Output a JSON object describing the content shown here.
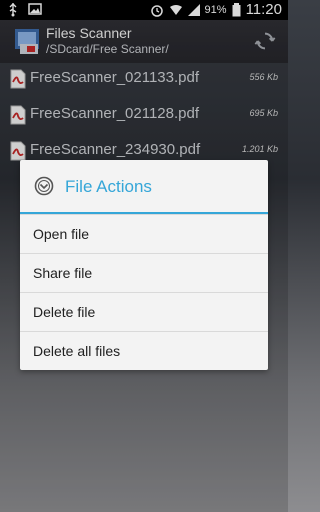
{
  "status_bar": {
    "time": "11:20",
    "battery_percent": "91%",
    "icons": [
      "usb-icon",
      "image-icon",
      "alarm-icon",
      "wifi-icon",
      "signal-icon",
      "battery-icon"
    ]
  },
  "action_bar": {
    "title": "Files Scanner",
    "subtitle": "/SDcard/Free Scanner/",
    "icons": [
      "app-icon",
      "refresh-icon"
    ]
  },
  "files": [
    {
      "name": "FreeScanner_021133.pdf",
      "size": "556 Kb"
    },
    {
      "name": "FreeScanner_021128.pdf",
      "size": "695 Kb"
    },
    {
      "name": "FreeScanner_234930.pdf",
      "size": "1.201 Kb"
    }
  ],
  "dialog": {
    "title": "File Actions",
    "items": [
      {
        "label": "Open file"
      },
      {
        "label": "Share file"
      },
      {
        "label": "Delete file"
      },
      {
        "label": "Delete all files"
      }
    ],
    "accent": "#35a6d8"
  }
}
